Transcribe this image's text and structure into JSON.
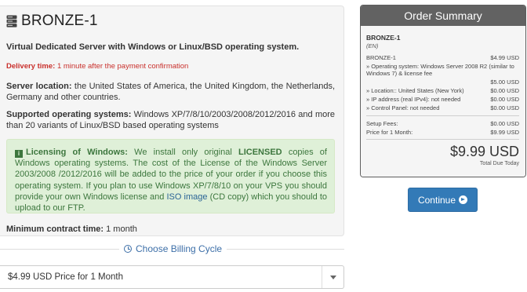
{
  "product": {
    "name": "BRONZE-1",
    "tagline": "Virtual Dedicated Server with Windows or Linux/BSD operating system.",
    "delivery_label": "Delivery time:",
    "delivery_value": " 1 minute after the payment confirmation",
    "location_label": "Server location:",
    "location_value": " the United States of America, the United Kingdom, the Netherlands, Germany and other countries.",
    "systems_label": "Supported operating systems:",
    "systems_value": " Windows XP/7/8/10/2003/2008/2012/2016 and more than 20 variants of Linux/BSD based operating systems",
    "licensing": {
      "title": "Licensing of Windows:",
      "text1": " We install only original ",
      "licensed": "LICENSED",
      "text2": " copies of Windows operating systems. The cost of the License of the Windows Server 2003/2008 /2012/2016 will be added to the price of your order if you choose this operating system. If you plan to use Windows XP/7/8/10 on your VPS you should provide your own Windows license and ",
      "iso_link": "ISO image",
      "text3": " (CD copy) which you should to upload to our FTP."
    },
    "contract_label": "Minimum contract time:",
    "contract_value": " 1 month"
  },
  "billing": {
    "header": "Choose Billing Cycle",
    "selected": "$4.99 USD Price for 1 Month"
  },
  "summary": {
    "title": "Order Summary",
    "product": "BRONZE-1",
    "group": "(EN)",
    "lines": [
      {
        "label": "BRONZE-1",
        "amount": "$4.99 USD"
      },
      {
        "label": "» Operating system: Windows Server 2008 R2 (similar to Windows 7) & license fee",
        "amount": ""
      },
      {
        "label": "",
        "amount": "$5.00 USD"
      },
      {
        "label": "» Location:: United States (New York)",
        "amount": "$0.00 USD"
      },
      {
        "label": "» IP address (real IPv4): not needed",
        "amount": "$0.00 USD"
      },
      {
        "label": "» Control Panel: not needed",
        "amount": "$0.00 USD"
      }
    ],
    "setup_label": "Setup Fees:",
    "setup_amount": "$0.00 USD",
    "price_label": "Price for 1 Month:",
    "price_amount": "$9.99 USD",
    "total": "$9.99 USD",
    "total_label": "Total Due Today"
  },
  "continue_label": "Continue"
}
